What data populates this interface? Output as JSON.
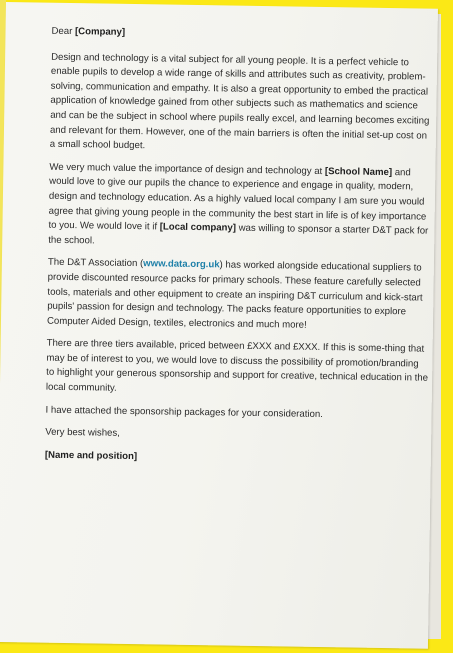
{
  "letter": {
    "salutation_prefix": "Dear ",
    "salutation_company": "[Company]",
    "para1": "Design and technology is a vital subject for all young people. It is a perfect vehicle to enable pupils to develop a wide range of skills and attributes such as creativity, problem-solving, communication and empathy. It is also a great opportunity to embed the practical application of knowledge gained from other subjects such as mathematics and science and can be the subject in school where pupils really excel, and learning becomes exciting and relevant for them. However, one of the main barriers is often the initial set-up cost on a small school budget.",
    "para2_a": "We very much value the importance of design and technology at ",
    "para2_school": "[School Name]",
    "para2_b": " and would love to give our pupils the chance to experience and engage in quality, modern, design and technology education. As a highly valued local company I am sure you would agree that giving young people in the community the best start in life is of key importance to you. We would love it if ",
    "para2_company": "[Local company]",
    "para2_c": " was willing to sponsor a starter D&T pack for the school.",
    "para3_a": "The D&T Association (",
    "para3_link": "www.data.org.uk",
    "para3_b": ") has worked alongside educational suppliers to provide discounted resource packs for primary schools. These feature carefully selected tools, materials and other equipment to create an inspiring D&T curriculum and kick-start pupils' passion for design and technology. The packs feature opportunities to explore Computer Aided Design, textiles, electronics and much more!",
    "para4": "There are three tiers available, priced between £XXX and £XXX. If this is some-thing that may be of interest to you, we would love to discuss the possibility of promotion/branding to highlight your generous sponsorship and support for creative, technical education in the local community.",
    "para5": "I have attached the sponsorship packages for your consideration.",
    "closing": "Very best wishes,",
    "signature": "[Name and position]"
  },
  "colors": {
    "frame": "#fbe816",
    "link": "#1c7fa8",
    "paper": "#f4f4ef"
  }
}
